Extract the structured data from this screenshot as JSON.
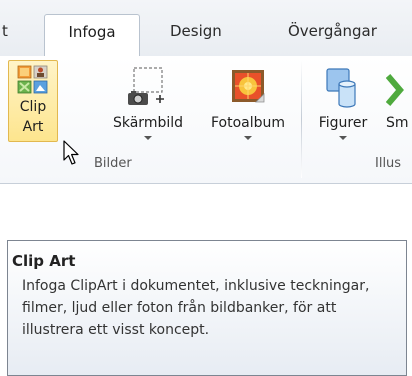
{
  "tabs": {
    "fragment": "t",
    "active": "Infoga",
    "design": "Design",
    "overgangar": "Övergångar"
  },
  "buttons": {
    "clipart_line1": "Clip",
    "clipart_line2": "Art",
    "skarmbild": "Skärmbild",
    "fotoalbum": "Fotoalbum",
    "figurer": "Figurer",
    "sm": "Sm"
  },
  "groups": {
    "bilder": "Bilder",
    "illus": "Illus"
  },
  "tooltip": {
    "title": "Clip Art",
    "body": "Infoga ClipArt i dokumentet, inklusive teckningar, filmer, ljud eller foton från bildbanker, för att illustrera ett visst koncept."
  },
  "icons": {
    "clipart": "clip-art-icon",
    "screenshot": "screenshot-icon",
    "photoalbum": "photo-album-icon",
    "shapes": "shapes-icon",
    "smartart": "smartart-icon",
    "cursor": "mouse-cursor-icon"
  }
}
